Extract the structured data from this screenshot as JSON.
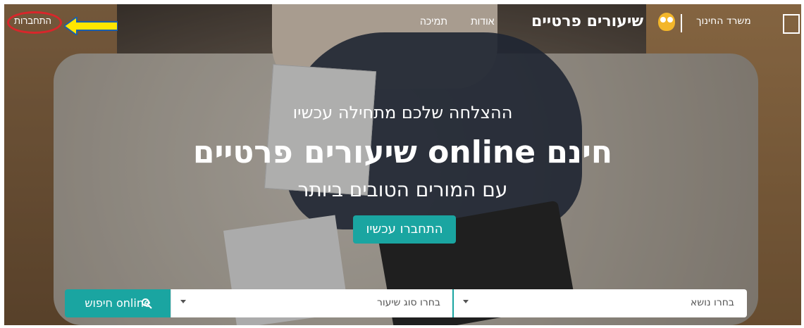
{
  "nav": {
    "login": "התחברות",
    "support": "תמיכה",
    "about": "אודות",
    "brand": "שיעורים פרטיים",
    "ministry": "משרד החינוך"
  },
  "hero": {
    "tagline": "ההצלחה שלכם מתחילה עכשיו",
    "headline": "שיעורים פרטיים online חינם",
    "subline": "עם המורים הטובים ביותר",
    "cta": "התחברו עכשיו"
  },
  "search": {
    "button": "חיפוש online",
    "lesson_type_placeholder": "בחרו סוג שיעור",
    "subject_placeholder": "בחרו נושא"
  },
  "colors": {
    "accent": "#1aa5a1",
    "annotation_red": "#d9262b",
    "annotation_yellow": "#ffe600"
  },
  "icons": {
    "search": "search-icon",
    "chevron": "chevron-down-icon",
    "arrow": "left-arrow-annotation-icon",
    "owl": "owl-logo-icon",
    "emblem": "state-emblem-icon"
  }
}
